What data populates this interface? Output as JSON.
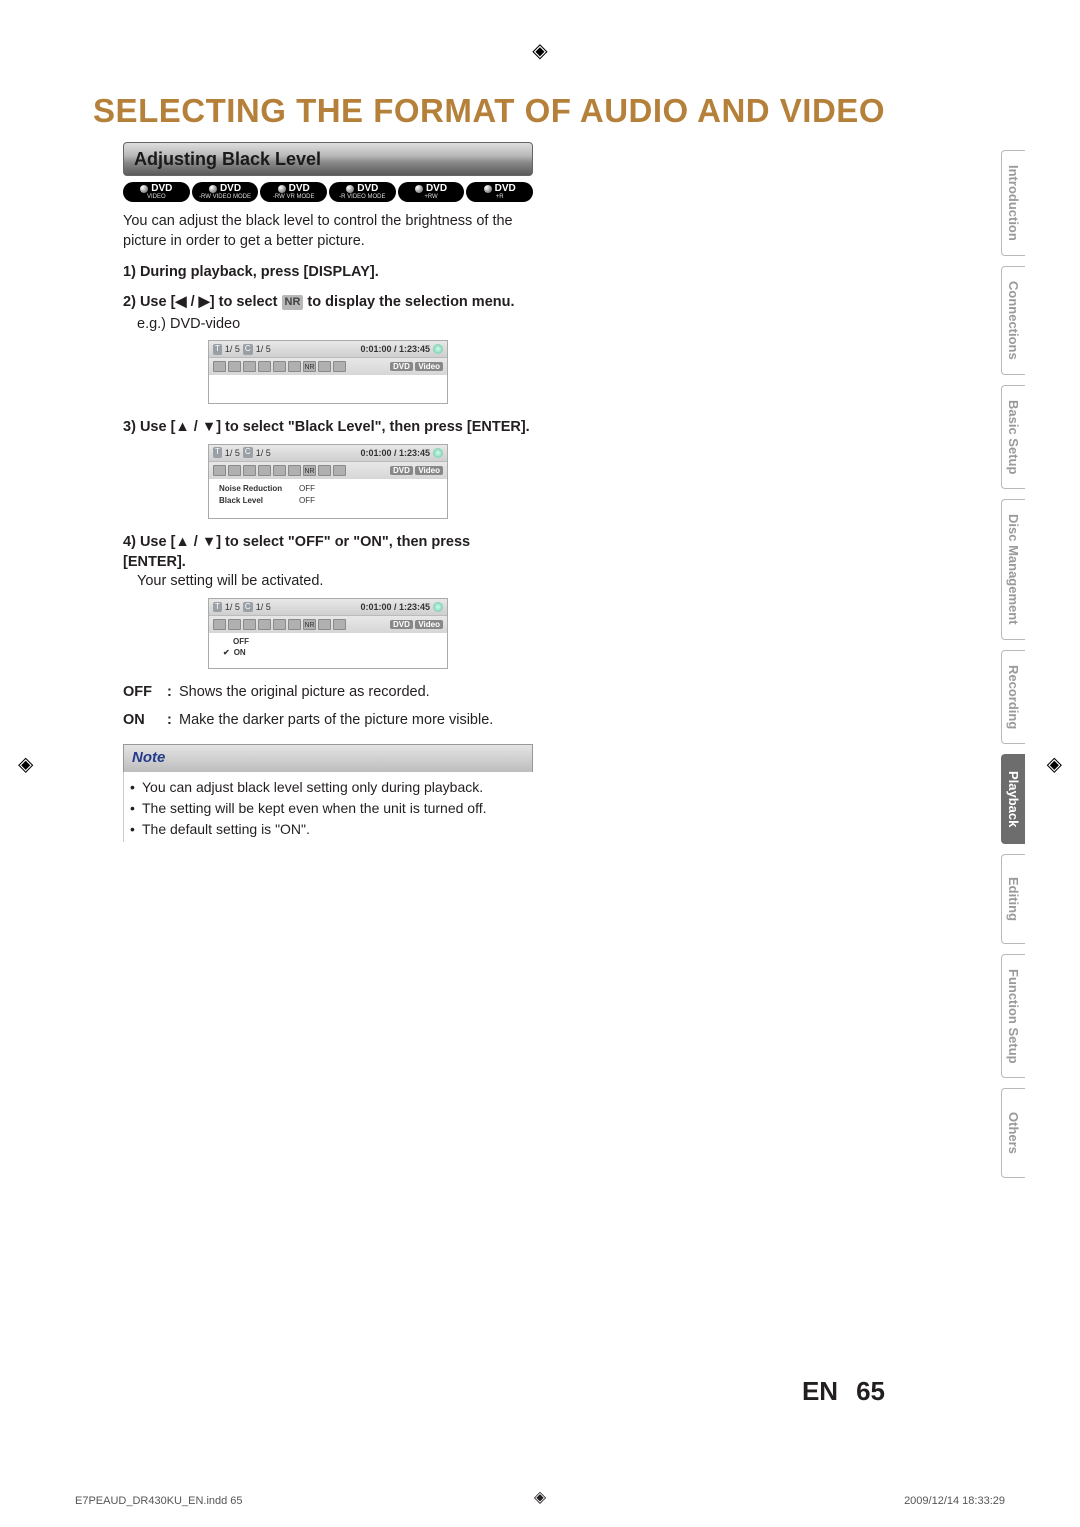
{
  "page_title": "SELECTING THE FORMAT OF AUDIO AND VIDEO",
  "section_heading": "Adjusting Black Level",
  "disc_badges": [
    {
      "top": "DVD",
      "sub": "VIDEO"
    },
    {
      "top": "DVD",
      "sub": "-RW VIDEO MODE"
    },
    {
      "top": "DVD",
      "sub": "-RW VR MODE"
    },
    {
      "top": "DVD",
      "sub": "-R VIDEO MODE"
    },
    {
      "top": "DVD",
      "sub": "+RW"
    },
    {
      "top": "DVD",
      "sub": "+R"
    }
  ],
  "intro": "You can adjust the black level to control the brightness of the picture in order to get a better picture.",
  "steps": {
    "s1": {
      "num": "1)",
      "text": "During playback, press [DISPLAY]."
    },
    "s2": {
      "num": "2)",
      "pre": "Use [",
      "arrows": "◀ / ▶",
      "mid": "] to select ",
      "nr": "NR",
      "post": " to display the selection menu."
    },
    "s2_eg": "e.g.) DVD-video",
    "s3": {
      "num": "3)",
      "pre": "Use [",
      "arrows": "▲ / ▼",
      "post": "] to select \"Black Level\", then press [ENTER]."
    },
    "s4": {
      "num": "4)",
      "pre": "Use [",
      "arrows": "▲ / ▼",
      "post": "] to select \"OFF\" or \"ON\", then press [ENTER]."
    },
    "s4_after": "Your setting will be activated."
  },
  "osd_common": {
    "t_label": "T",
    "t_val": "1/  5",
    "c_label": "C",
    "c_val": "1/  5",
    "time": "0:01:00 / 1:23:45",
    "disc_label_a": "DVD",
    "disc_label_b": "Video",
    "nr_text": "NR"
  },
  "osd2_menu": [
    {
      "k": "Noise Reduction",
      "v": "OFF"
    },
    {
      "k": "Black Level",
      "v": "OFF"
    }
  ],
  "osd3_options": [
    {
      "label": "OFF",
      "selected": false
    },
    {
      "label": "ON",
      "selected": true
    }
  ],
  "defs": {
    "off": {
      "key": "OFF",
      "val": "Shows the original picture as recorded."
    },
    "on": {
      "key": "ON",
      "val": "Make the darker parts of the picture more visible."
    }
  },
  "note_heading": "Note",
  "notes": [
    "You can adjust black level setting only during playback.",
    "The setting will be kept even when the unit is turned off.",
    "The default setting is \"ON\"."
  ],
  "tabs": [
    "Introduction",
    "Connections",
    "Basic Setup",
    "Disc Management",
    "Recording",
    "Playback",
    "Editing",
    "Function Setup",
    "Others"
  ],
  "active_tab": "Playback",
  "page_number": {
    "en": "EN",
    "num": "65"
  },
  "footer": {
    "left": "E7PEAUD_DR430KU_EN.indd   65",
    "right": "2009/12/14   18:33:29"
  },
  "colon": ":"
}
